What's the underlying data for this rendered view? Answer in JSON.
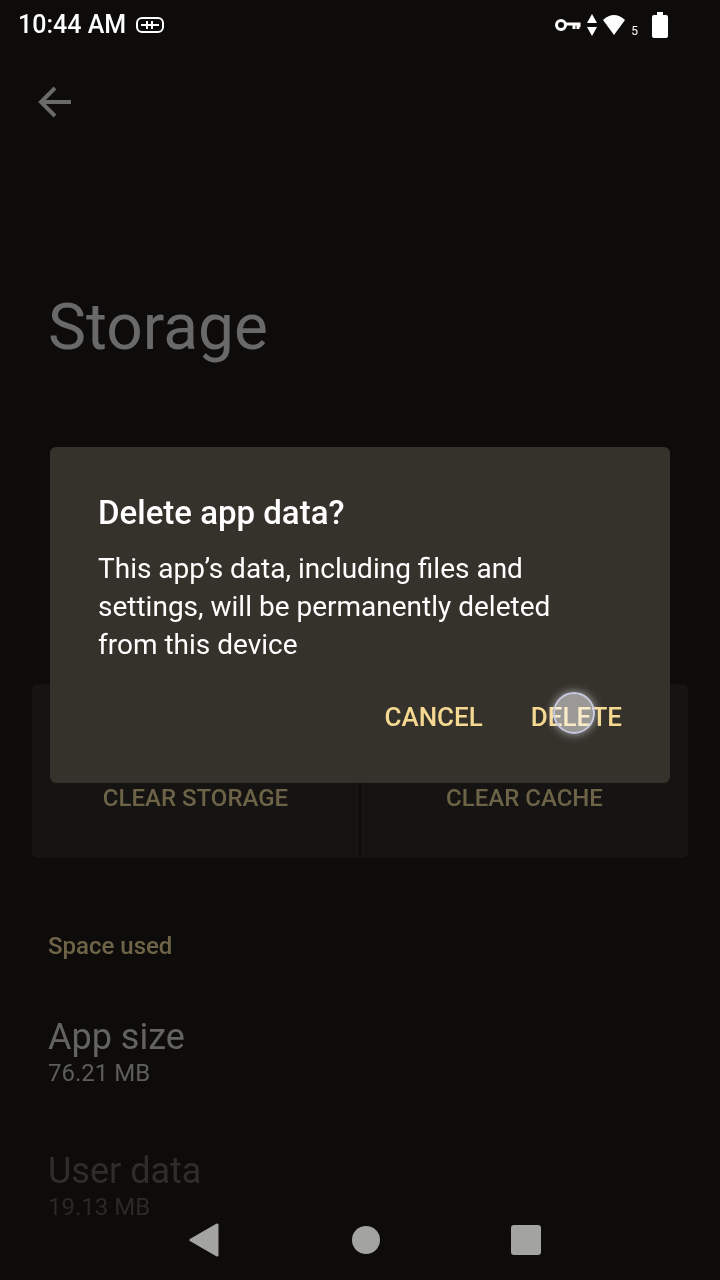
{
  "status_bar": {
    "time": "10:44 AM",
    "wifi_badge": "5"
  },
  "page": {
    "title": "Storage",
    "actions": [
      {
        "label": "CLEAR STORAGE"
      },
      {
        "label": "CLEAR CACHE"
      }
    ],
    "section": "Space used",
    "items": [
      {
        "title": "App size",
        "value": "76.21 MB"
      },
      {
        "title": "User data",
        "value": "19.13 MB"
      }
    ]
  },
  "dialog": {
    "title": "Delete app data?",
    "message": "This app’s data, including files and settings, will be permanently deleted from this device",
    "buttons": [
      {
        "label": "CANCEL",
        "pressed": false
      },
      {
        "label": "DELETE",
        "pressed": true
      }
    ]
  }
}
